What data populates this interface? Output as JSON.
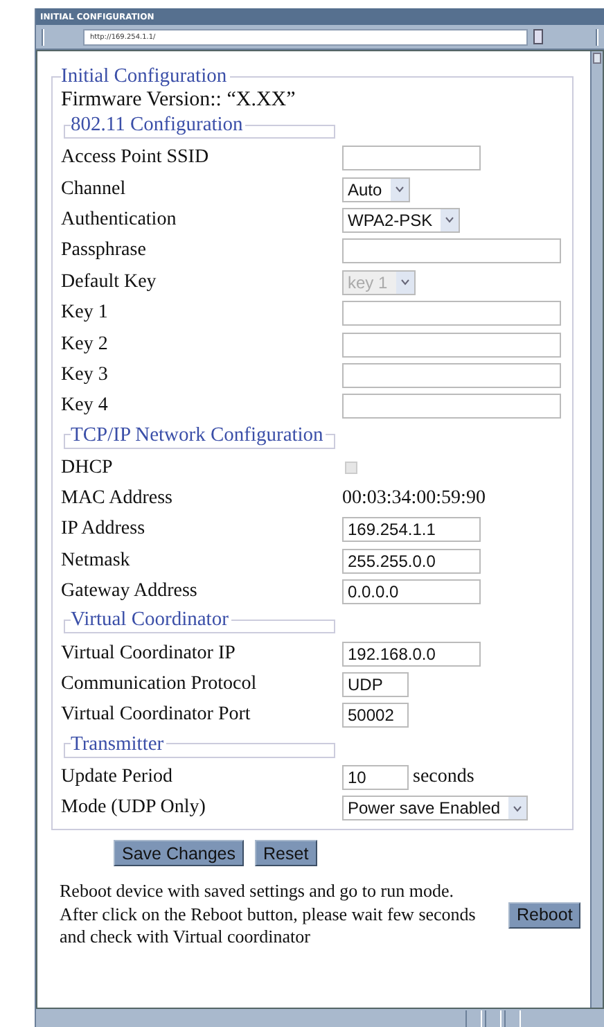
{
  "window": {
    "title": "INITIAL CONFIGURATION",
    "address": "http://169.254.1.1/"
  },
  "form": {
    "legend": "Initial Configuration",
    "firmware": "Firmware Version:: “X.XX”",
    "sections": [
      {
        "legend": "802.11 Configuration",
        "rows": [
          {
            "label": "Access Point SSID",
            "kind": "field",
            "value": ""
          },
          {
            "label": "Channel",
            "kind": "select",
            "value": "Auto",
            "disabled": false
          },
          {
            "label": "Authentication",
            "kind": "select",
            "value": "WPA2-PSK",
            "disabled": false
          },
          {
            "label": "Passphrase",
            "kind": "wide",
            "value": ""
          },
          {
            "label": "Default Key",
            "kind": "select",
            "value": "key 1",
            "disabled": true
          },
          {
            "label": "Key 1",
            "kind": "wide",
            "value": ""
          },
          {
            "label": "Key 2",
            "kind": "wide",
            "value": ""
          },
          {
            "label": "Key 3",
            "kind": "wide",
            "value": ""
          },
          {
            "label": "Key 4",
            "kind": "wide",
            "value": ""
          }
        ]
      },
      {
        "legend": "TCP/IP Network Configuration",
        "rows": [
          {
            "label": "DHCP",
            "kind": "checkbox",
            "checked": false,
            "disabled": true
          },
          {
            "label": "MAC Address",
            "kind": "static",
            "value": "00:03:34:00:59:90"
          },
          {
            "label": "IP Address",
            "kind": "field",
            "value": "169.254.1.1"
          },
          {
            "label": "Netmask",
            "kind": "field",
            "value": "255.255.0.0"
          },
          {
            "label": "Gateway Address",
            "kind": "field",
            "value": "0.0.0.0"
          }
        ]
      },
      {
        "legend": "Virtual Coordinator",
        "rows": [
          {
            "label": "Virtual Coordinator IP",
            "kind": "field",
            "value": "192.168.0.0"
          },
          {
            "label": "Communication Protocol",
            "kind": "narrow",
            "value": "UDP"
          },
          {
            "label": "Virtual Coordinator Port",
            "kind": "narrow",
            "value": "50002"
          }
        ]
      },
      {
        "legend": "Transmitter",
        "rows": [
          {
            "label": "Update Period",
            "kind": "narrow",
            "value": "10",
            "suffix": "seconds"
          },
          {
            "label": "Mode (UDP Only)",
            "kind": "select",
            "value": "Power save Enabled",
            "disabled": false
          }
        ]
      }
    ]
  },
  "buttons": [
    "Save Changes",
    "Reset"
  ],
  "reboot": {
    "lines": [
      "Reboot device with saved settings and go to run mode.",
      "After click on the Reboot button, please wait few seconds",
      "and check with Virtual coordinator"
    ],
    "button": "Reboot"
  }
}
